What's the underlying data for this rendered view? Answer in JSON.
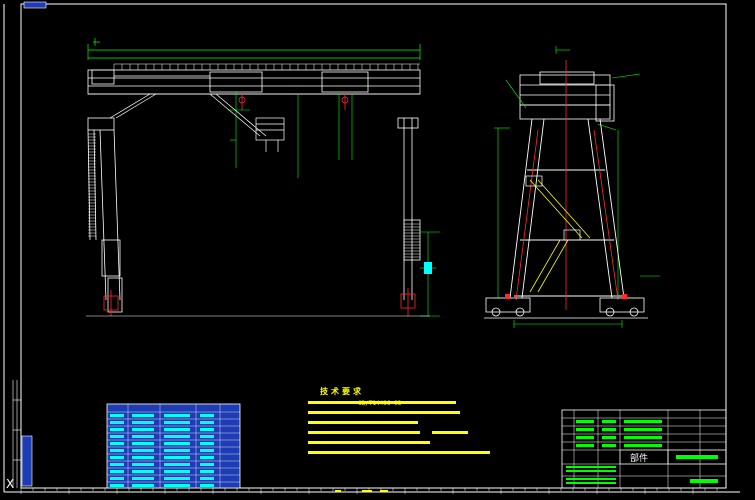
{
  "drawing": {
    "spec_line_1": "1.",
    "standard_code": "GB/T14406—93",
    "notes_title": "技术要求",
    "title_block_stamp": "部件",
    "bottom_left_x_mark": "X"
  },
  "colors": {
    "background": "#000000",
    "frame": "#ffffff",
    "structure": "#ffffff",
    "dimension": "#00ff00",
    "centerline": "#ff2a2a",
    "annotation": "#ffff00",
    "hatch": "#00ffff",
    "table_fill": "#1e3cb4",
    "title_text": "#ffffff"
  }
}
